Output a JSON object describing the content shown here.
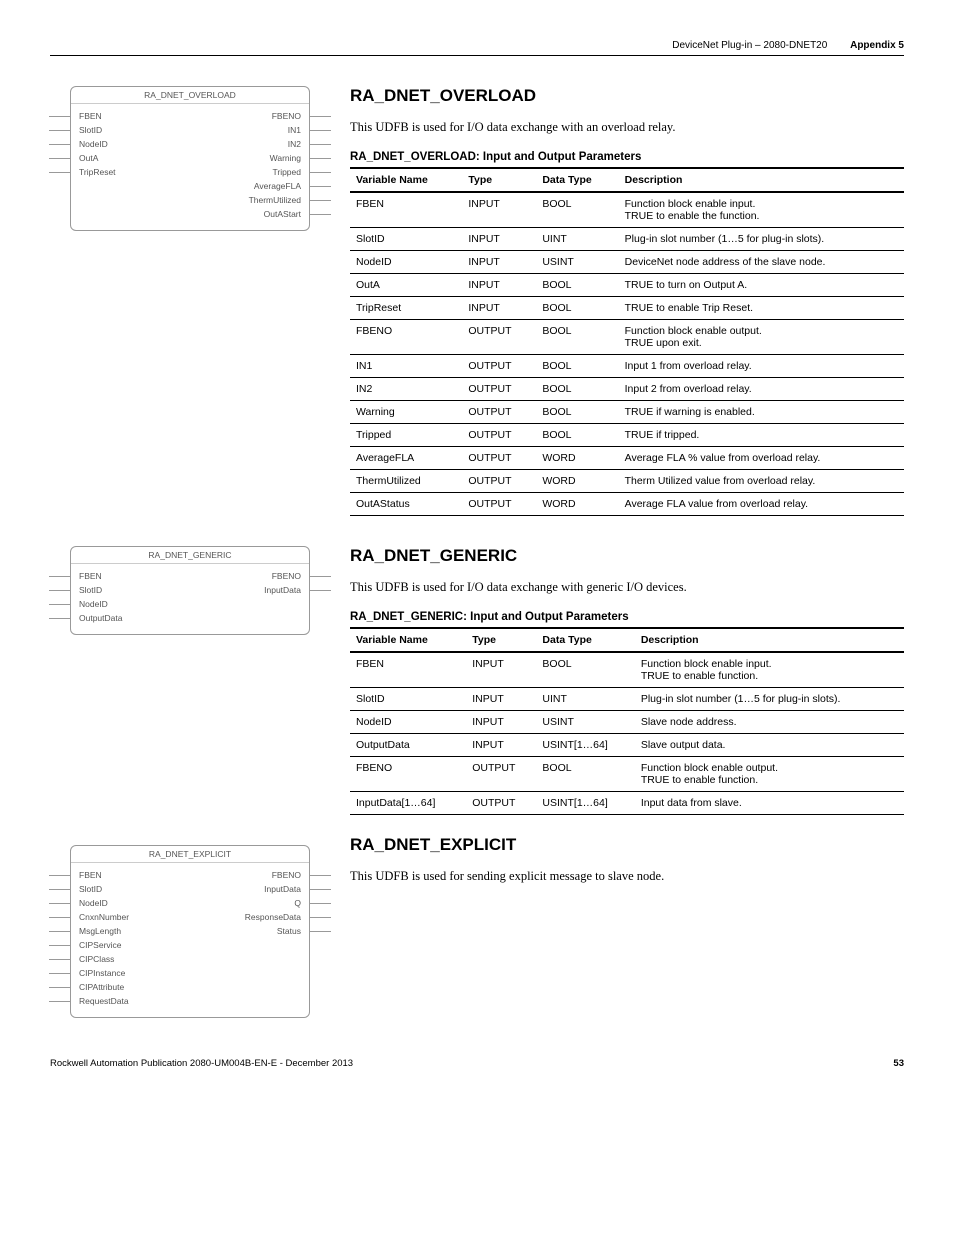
{
  "header": {
    "doc": "DeviceNet Plug-in – 2080-DNET20",
    "appendix": "Appendix 5"
  },
  "section1": {
    "heading": "RA_DNET_OVERLOAD",
    "intro": "This UDFB is used for I/O data exchange with an overload relay.",
    "caption": "RA_DNET_OVERLOAD: Input and Output Parameters",
    "block_title": "RA_DNET_OVERLOAD",
    "inputs": [
      "FBEN",
      "SlotID",
      "NodeID",
      "OutA",
      "TripReset"
    ],
    "outputs": [
      "FBENO",
      "IN1",
      "IN2",
      "Warning",
      "Tripped",
      "AverageFLA",
      "ThermUtilized",
      "OutAStart"
    ],
    "headers": [
      "Variable Name",
      "Type",
      "Data Type",
      "Description"
    ],
    "rows": [
      [
        "FBEN",
        "INPUT",
        "BOOL",
        "Function block enable input.\nTRUE to enable the function."
      ],
      [
        "SlotID",
        "INPUT",
        "UINT",
        "Plug-in slot number (1…5 for plug-in slots)."
      ],
      [
        "NodeID",
        "INPUT",
        "USINT",
        "DeviceNet node address of the slave node."
      ],
      [
        "OutA",
        "INPUT",
        "BOOL",
        "TRUE to turn on Output A."
      ],
      [
        "TripReset",
        "INPUT",
        "BOOL",
        "TRUE to enable Trip Reset."
      ],
      [
        "FBENO",
        "OUTPUT",
        "BOOL",
        "Function block enable output.\nTRUE upon exit."
      ],
      [
        "IN1",
        "OUTPUT",
        "BOOL",
        "Input 1 from overload relay."
      ],
      [
        "IN2",
        "OUTPUT",
        "BOOL",
        "Input 2 from overload relay."
      ],
      [
        "Warning",
        "OUTPUT",
        "BOOL",
        "TRUE if warning is enabled."
      ],
      [
        "Tripped",
        "OUTPUT",
        "BOOL",
        "TRUE if tripped."
      ],
      [
        "AverageFLA",
        "OUTPUT",
        "WORD",
        "Average FLA % value from overload relay."
      ],
      [
        "ThermUtilized",
        "OUTPUT",
        "WORD",
        "Therm Utilized value from overload relay."
      ],
      [
        "OutAStatus",
        "OUTPUT",
        "WORD",
        "Average FLA value from overload relay."
      ]
    ]
  },
  "section2": {
    "heading": "RA_DNET_GENERIC",
    "intro": "This UDFB is used for I/O data exchange with  generic I/O devices.",
    "caption": "RA_DNET_GENERIC: Input and Output Parameters",
    "block_title": "RA_DNET_GENERIC",
    "inputs": [
      "FBEN",
      "SlotID",
      "NodeID",
      "OutputData"
    ],
    "outputs": [
      "FBENO",
      "InputData"
    ],
    "headers": [
      "Variable Name",
      "Type",
      "Data Type",
      "Description"
    ],
    "rows": [
      [
        "FBEN",
        "INPUT",
        "BOOL",
        "Function block enable input.\nTRUE to enable function."
      ],
      [
        "SlotID",
        "INPUT",
        "UINT",
        "Plug-in slot number (1…5 for plug-in slots)."
      ],
      [
        "NodeID",
        "INPUT",
        "USINT",
        "Slave node address."
      ],
      [
        "OutputData",
        "INPUT",
        "USINT[1…64]",
        "Slave output data."
      ],
      [
        "FBENO",
        "OUTPUT",
        "BOOL",
        "Function block enable output.\nTRUE to enable function."
      ],
      [
        "InputData[1…64]",
        "OUTPUT",
        "USINT[1…64]",
        "Input data from slave."
      ]
    ]
  },
  "section3": {
    "heading": "RA_DNET_EXPLICIT",
    "intro": "This UDFB is used for sending explicit message to slave node.",
    "block_title": "RA_DNET_EXPLICIT",
    "inputs": [
      "FBEN",
      "SlotID",
      "NodeID",
      "CnxnNumber",
      "MsgLength",
      "CIPService",
      "CIPClass",
      "CIPInstance",
      "CIPAttribute",
      "RequestData"
    ],
    "outputs": [
      "FBENO",
      "InputData",
      "Q",
      "ResponseData",
      "Status"
    ]
  },
  "footer": {
    "pub": "Rockwell Automation Publication 2080-UM004B-EN-E - December 2013",
    "page": "53"
  }
}
